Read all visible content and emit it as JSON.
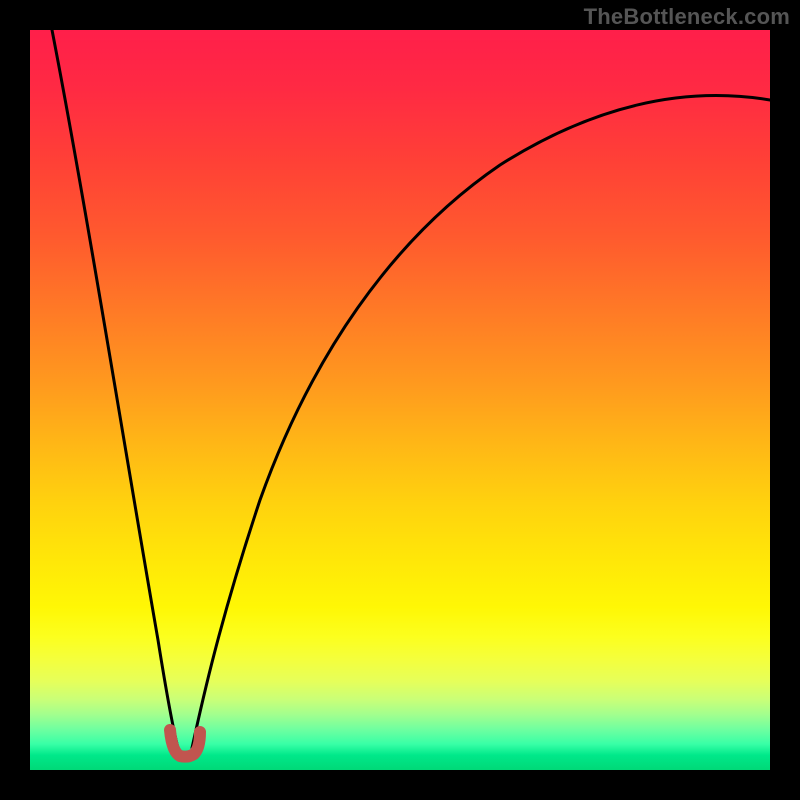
{
  "attribution": "TheBottleneck.com",
  "chart_data": {
    "type": "line",
    "title": "",
    "xlabel": "",
    "ylabel": "",
    "xlim": [
      0,
      100
    ],
    "ylim": [
      0,
      100
    ],
    "grid": false,
    "legend": false,
    "notes": "Background is a vertical color gradient from red (top, high values) through orange/yellow to green (bottom, low values). Minimum of the V-shaped curve sits near x≈20, y≈2. No axis ticks or numeric labels are shown.",
    "series": [
      {
        "name": "left-branch",
        "x": [
          3,
          5,
          7,
          9,
          11,
          13,
          15,
          17,
          18.5,
          19.5
        ],
        "values": [
          100,
          88,
          75,
          62,
          49,
          37,
          25,
          14,
          7,
          3
        ]
      },
      {
        "name": "right-branch",
        "x": [
          21.5,
          23,
          25,
          28,
          32,
          37,
          43,
          50,
          58,
          67,
          77,
          88,
          100
        ],
        "values": [
          3,
          8,
          16,
          27,
          38,
          48,
          57,
          65,
          72,
          78,
          83,
          87,
          90
        ]
      },
      {
        "name": "cusp-marker",
        "x": [
          18.8,
          19.4,
          20.0,
          20.6,
          21.2,
          21.8
        ],
        "values": [
          5.0,
          2.8,
          2.0,
          2.0,
          2.8,
          5.0
        ]
      }
    ],
    "gradient_stops": [
      {
        "pos": 0.0,
        "color": "#ff1f4a"
      },
      {
        "pos": 0.18,
        "color": "#ff4136"
      },
      {
        "pos": 0.38,
        "color": "#ff7a26"
      },
      {
        "pos": 0.56,
        "color": "#ffb716"
      },
      {
        "pos": 0.72,
        "color": "#ffe808"
      },
      {
        "pos": 0.85,
        "color": "#f4ff3c"
      },
      {
        "pos": 0.93,
        "color": "#a2ff8e"
      },
      {
        "pos": 1.0,
        "color": "#00d977"
      }
    ],
    "cusp_marker_color": "#c1554f"
  }
}
